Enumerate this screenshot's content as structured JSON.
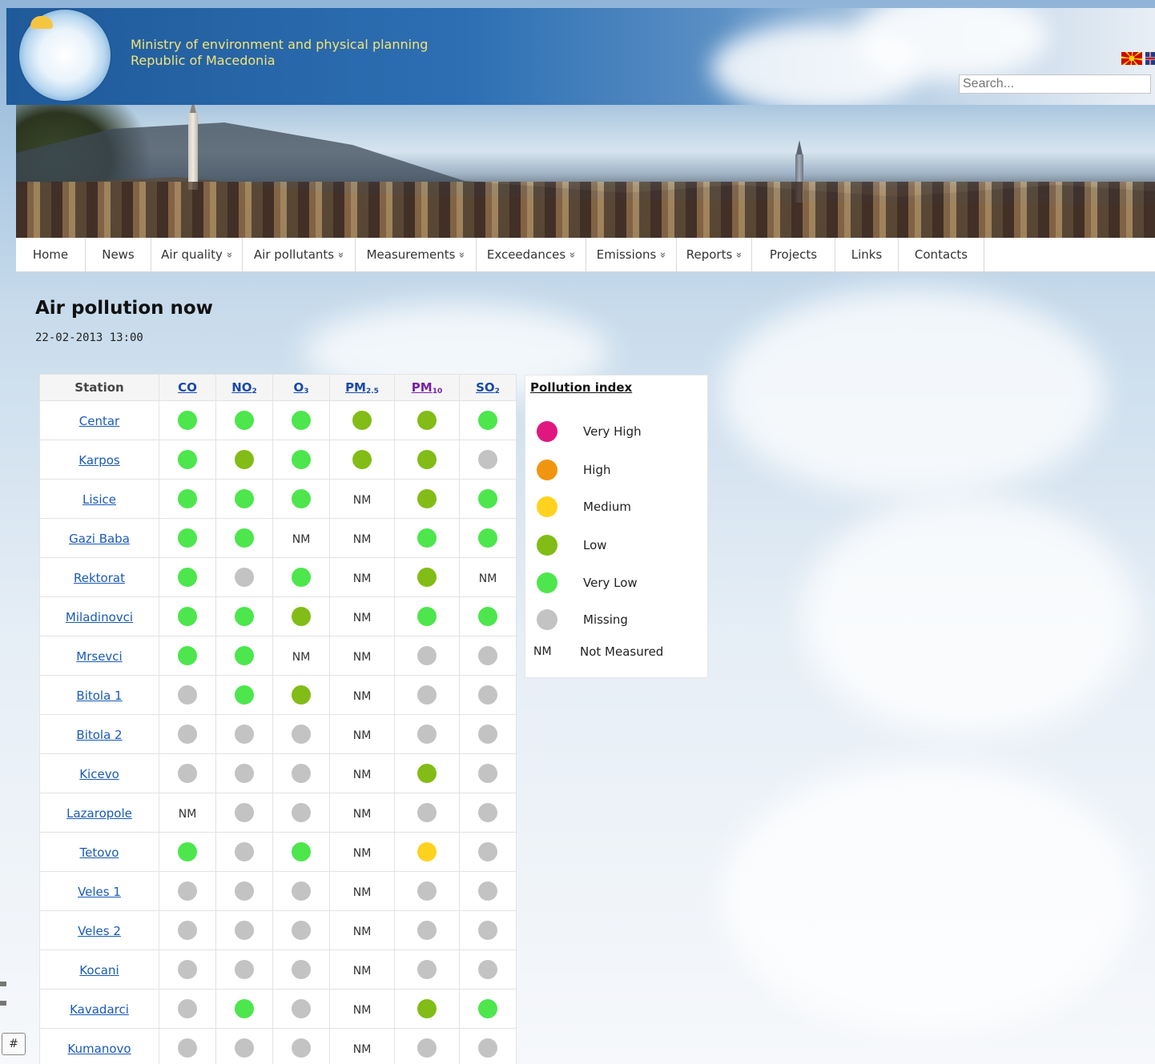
{
  "header": {
    "ministry_line1": "Ministry of environment and physical planning",
    "ministry_line2": "Republic of Macedonia",
    "search_placeholder": "Search..."
  },
  "nav": [
    {
      "label": "Home",
      "dropdown": false
    },
    {
      "label": "News",
      "dropdown": false
    },
    {
      "label": "Air quality",
      "dropdown": true
    },
    {
      "label": "Air pollutants",
      "dropdown": true
    },
    {
      "label": "Measurements",
      "dropdown": true
    },
    {
      "label": "Exceedances",
      "dropdown": true
    },
    {
      "label": "Emissions",
      "dropdown": true
    },
    {
      "label": "Reports",
      "dropdown": true
    },
    {
      "label": "Projects",
      "dropdown": false
    },
    {
      "label": "Links",
      "dropdown": false
    },
    {
      "label": "Contacts",
      "dropdown": false
    }
  ],
  "main": {
    "title": "Air pollution now",
    "datetime": "22-02-2013 13:00"
  },
  "table": {
    "station_header": "Station",
    "pollutants": [
      {
        "base": "CO",
        "sub": ""
      },
      {
        "base": "NO",
        "sub": "2"
      },
      {
        "base": "O",
        "sub": "3"
      },
      {
        "base": "PM",
        "sub": "2.5"
      },
      {
        "base": "PM",
        "sub": "10"
      },
      {
        "base": "SO",
        "sub": "2"
      }
    ],
    "rows": [
      {
        "station": "Centar",
        "values": [
          "VL",
          "VL",
          "VL",
          "L",
          "L",
          "VL"
        ]
      },
      {
        "station": "Karpos",
        "values": [
          "VL",
          "L",
          "VL",
          "L",
          "L",
          "X"
        ]
      },
      {
        "station": "Lisice",
        "values": [
          "VL",
          "VL",
          "VL",
          "NM",
          "L",
          "VL"
        ]
      },
      {
        "station": "Gazi Baba",
        "values": [
          "VL",
          "VL",
          "NM",
          "NM",
          "VL",
          "VL"
        ]
      },
      {
        "station": "Rektorat",
        "values": [
          "VL",
          "X",
          "VL",
          "NM",
          "L",
          "NM"
        ]
      },
      {
        "station": "Miladinovci",
        "values": [
          "VL",
          "VL",
          "L",
          "NM",
          "VL",
          "VL"
        ]
      },
      {
        "station": "Mrsevci",
        "values": [
          "VL",
          "VL",
          "NM",
          "NM",
          "X",
          "X"
        ]
      },
      {
        "station": "Bitola 1",
        "values": [
          "X",
          "VL",
          "L",
          "NM",
          "X",
          "X"
        ]
      },
      {
        "station": "Bitola 2",
        "values": [
          "X",
          "X",
          "X",
          "NM",
          "X",
          "X"
        ]
      },
      {
        "station": "Kicevo",
        "values": [
          "X",
          "X",
          "X",
          "NM",
          "L",
          "X"
        ]
      },
      {
        "station": "Lazaropole",
        "values": [
          "NM",
          "X",
          "X",
          "NM",
          "X",
          "X"
        ]
      },
      {
        "station": "Tetovo",
        "values": [
          "VL",
          "X",
          "VL",
          "NM",
          "M",
          "X"
        ]
      },
      {
        "station": "Veles 1",
        "values": [
          "X",
          "X",
          "X",
          "NM",
          "X",
          "X"
        ]
      },
      {
        "station": "Veles 2",
        "values": [
          "X",
          "X",
          "X",
          "NM",
          "X",
          "X"
        ]
      },
      {
        "station": "Kocani",
        "values": [
          "X",
          "X",
          "X",
          "NM",
          "X",
          "X"
        ]
      },
      {
        "station": "Kavadarci",
        "values": [
          "X",
          "VL",
          "X",
          "NM",
          "L",
          "VL"
        ]
      },
      {
        "station": "Kumanovo",
        "values": [
          "X",
          "X",
          "X",
          "NM",
          "X",
          "X"
        ]
      }
    ]
  },
  "legend": {
    "title": "Pollution index",
    "items": [
      {
        "code": "VH",
        "label": "Very High",
        "color": "#e0177f"
      },
      {
        "code": "H",
        "label": "High",
        "color": "#f0950f"
      },
      {
        "code": "M",
        "label": "Medium",
        "color": "#ffd21f"
      },
      {
        "code": "L",
        "label": "Low",
        "color": "#82bc16"
      },
      {
        "code": "VL",
        "label": "Very Low",
        "color": "#4de64d"
      },
      {
        "code": "X",
        "label": "Missing",
        "color": "#c3c3c3"
      },
      {
        "code": "NM",
        "label": "Not Measured",
        "text": "NM"
      }
    ]
  },
  "footer_button": "#"
}
